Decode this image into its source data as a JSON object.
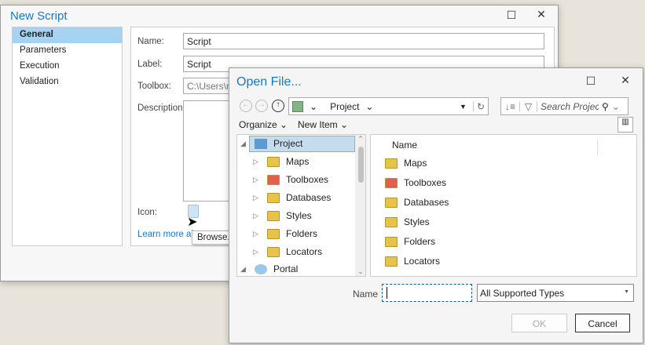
{
  "new_script": {
    "title": "New Script",
    "nav": [
      "General",
      "Parameters",
      "Execution",
      "Validation"
    ],
    "name_label": "Name:",
    "name_value": "Script",
    "label_label": "Label:",
    "label_value": "Script",
    "toolbox_label": "Toolbox:",
    "toolbox_value": "C:\\Users\\mr",
    "description_label": "Description:",
    "icon_label": "Icon:",
    "learn_more": "Learn more ab",
    "browse_tooltip": "Browse..."
  },
  "open_file": {
    "title": "Open File...",
    "location": "Project",
    "search_placeholder": "Search Projec",
    "organize": "Organize",
    "new_item": "New Item",
    "tree": [
      "Project",
      "Maps",
      "Toolboxes",
      "Databases",
      "Styles",
      "Folders",
      "Locators",
      "Portal"
    ],
    "column_name": "Name",
    "items": [
      "Maps",
      "Toolboxes",
      "Databases",
      "Styles",
      "Folders",
      "Locators"
    ],
    "name_label": "Name",
    "name_value": "",
    "file_type": "All Supported Types",
    "ok": "OK",
    "cancel": "Cancel"
  }
}
